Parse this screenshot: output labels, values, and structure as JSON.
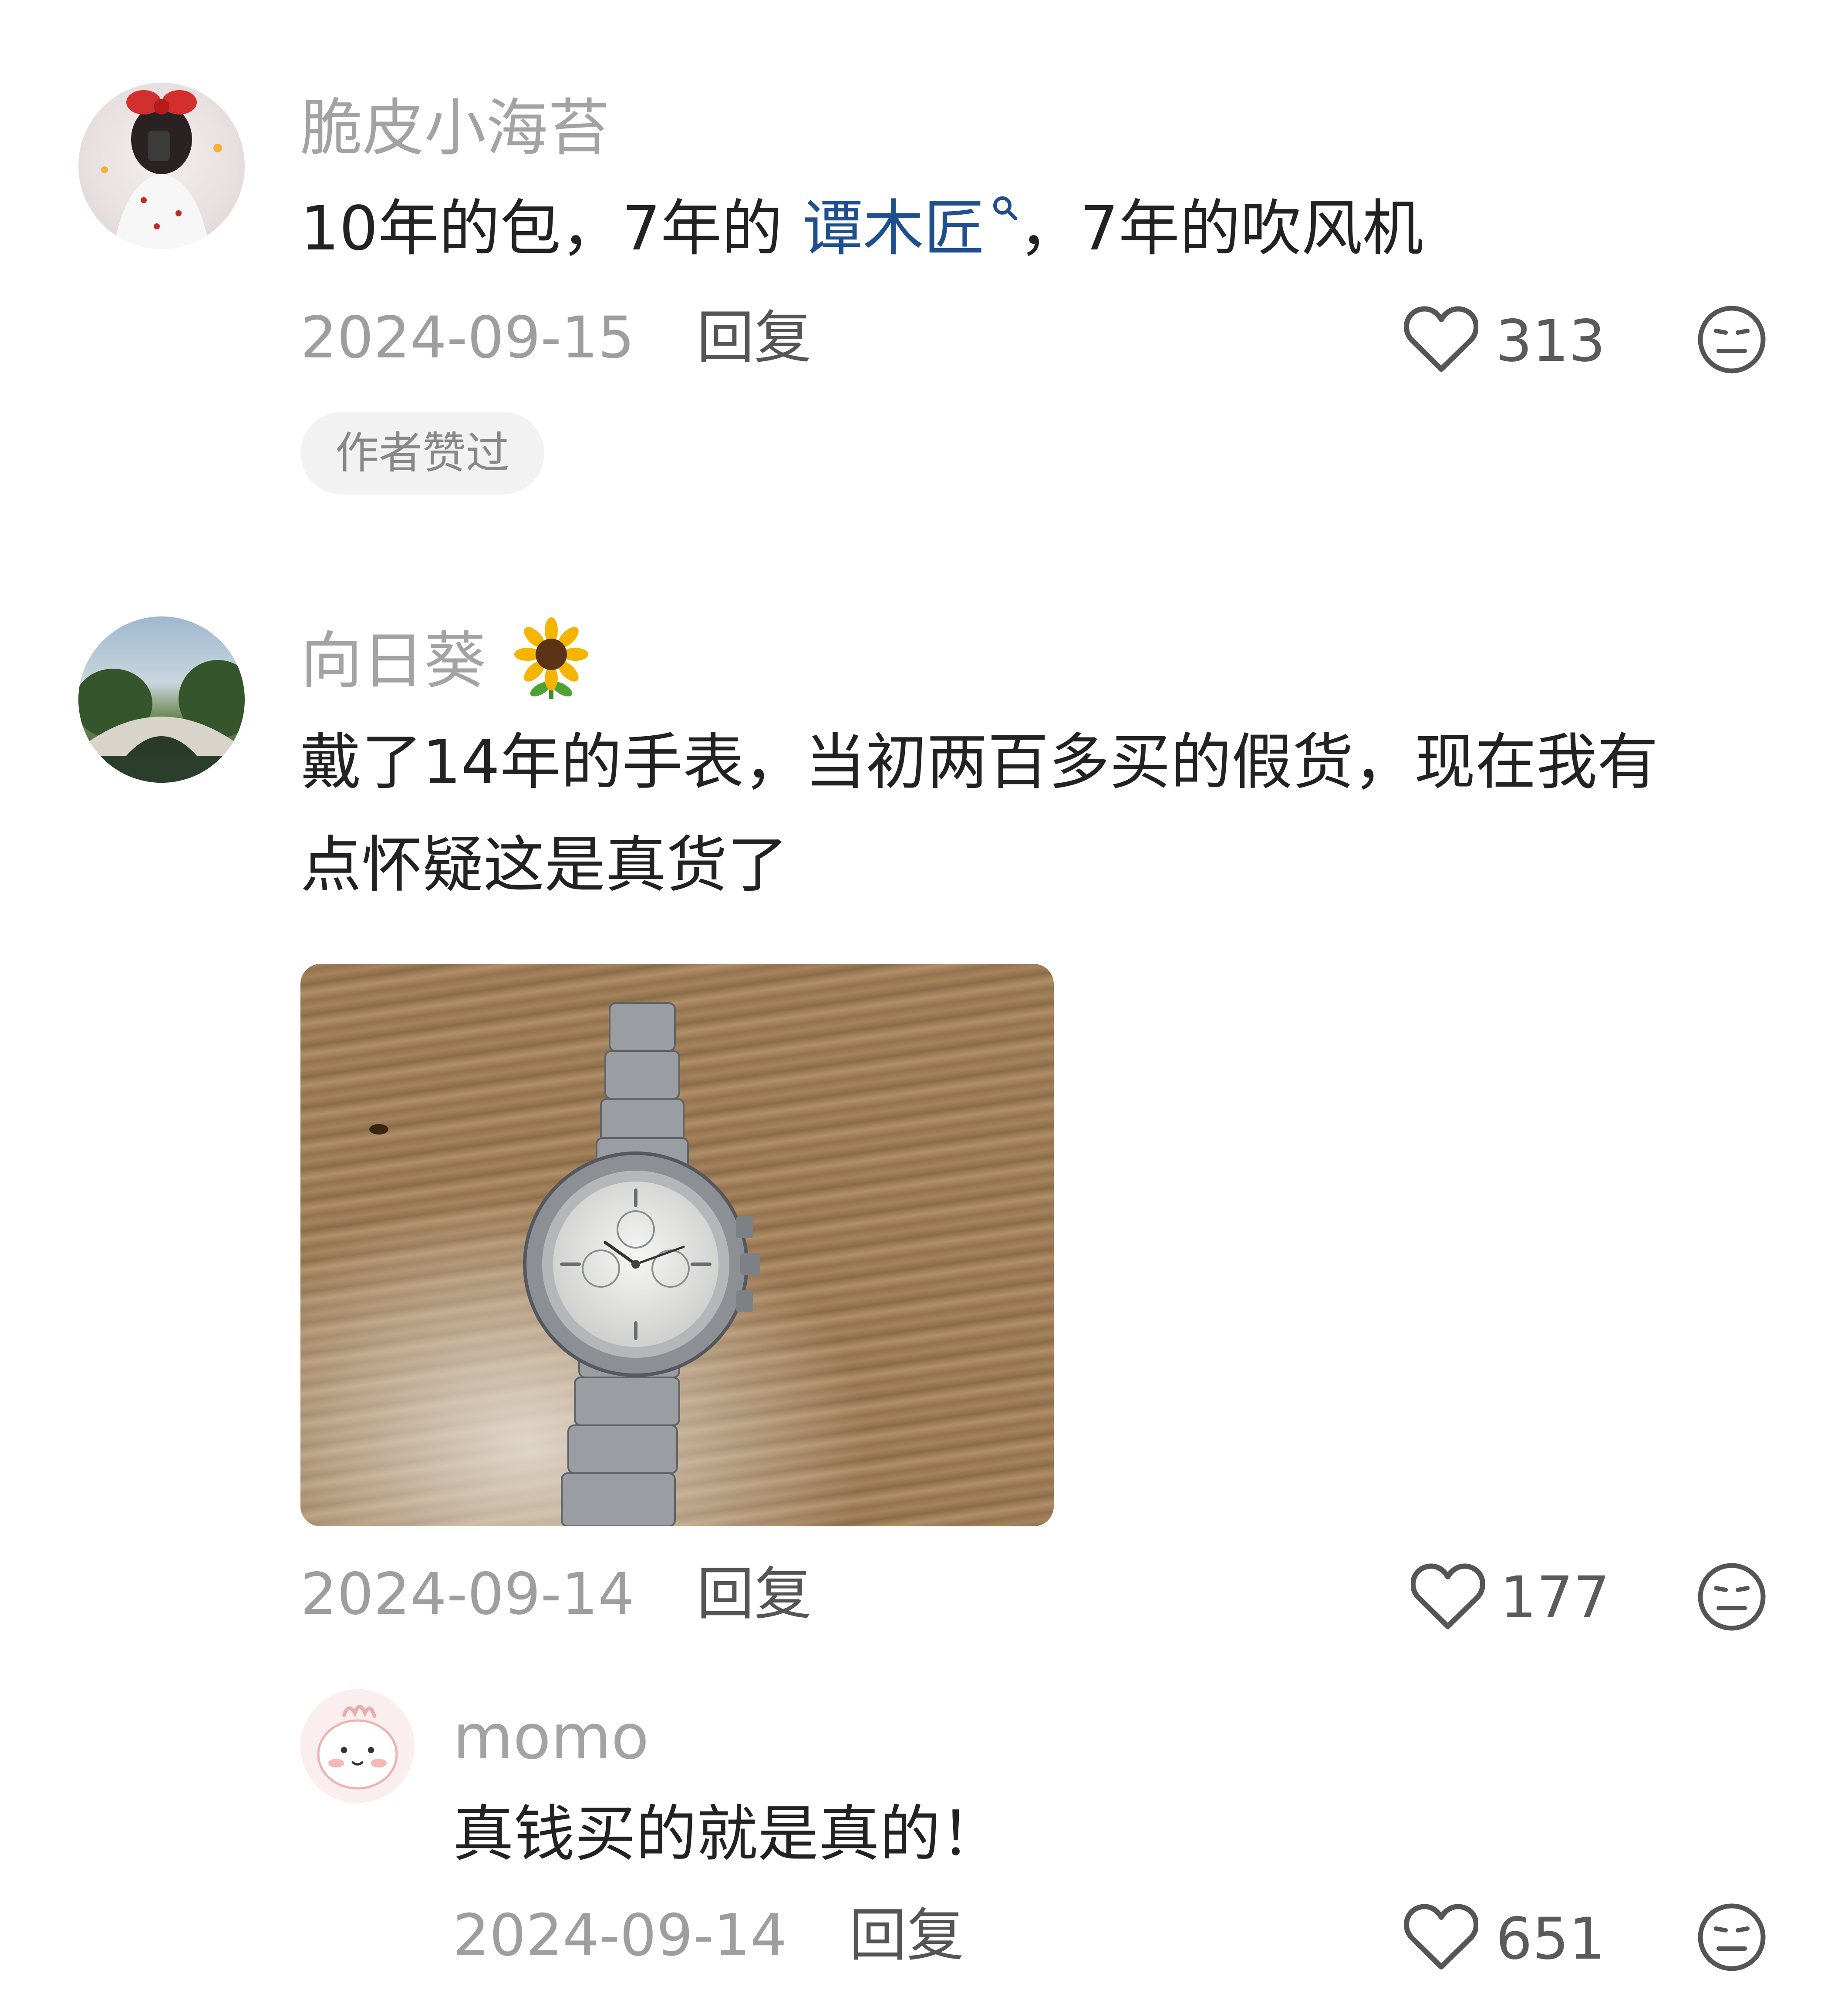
{
  "comments": [
    {
      "username": "脆皮小海苔",
      "text_before": "10年的包，7年的 ",
      "link_text": "谭木匠",
      "text_after": "，7年的吹风机",
      "date": "2024-09-15",
      "reply_label": "回复",
      "likes": "313",
      "tag": "作者赞过"
    },
    {
      "username": "向日葵",
      "text_line1": "戴了14年的手表，当初两百多买的假货，现在我有",
      "text_line2": "点怀疑这是真货了",
      "date": "2024-09-14",
      "reply_label": "回复",
      "likes": "177",
      "reply": {
        "username": "momo",
        "text": "真钱买的就是真的！",
        "date": "2024-09-14",
        "reply_label": "回复",
        "likes": "651"
      }
    }
  ],
  "icons": {
    "like": "heart-outline-icon",
    "dislike": "meh-face-icon",
    "search": "search-icon",
    "sunflower": "sunflower-emoji-icon"
  },
  "colors": {
    "link": "#1f4f8f",
    "username": "#a3a3a3",
    "text": "#222222"
  }
}
